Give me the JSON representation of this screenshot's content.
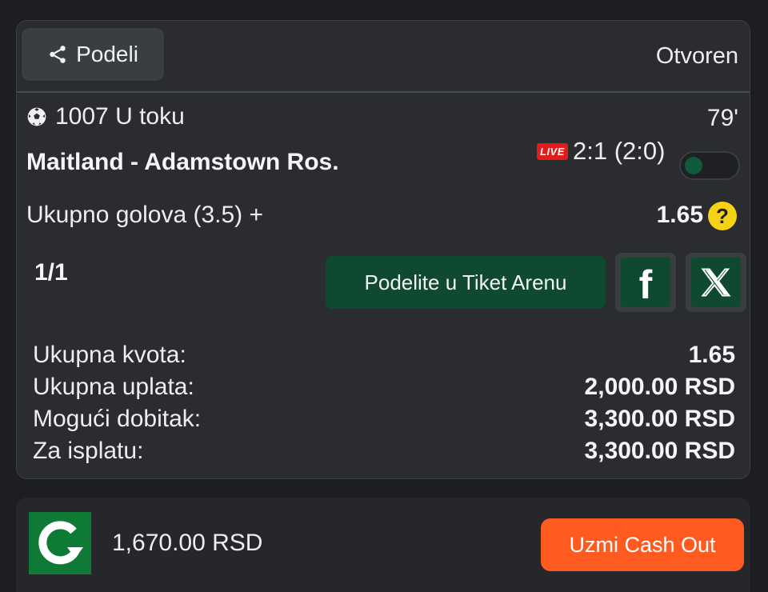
{
  "header": {
    "share_label": "Podeli",
    "status": "Otvoren"
  },
  "event": {
    "code_status": "1007 U toku",
    "minute": "79'",
    "teams": "Maitland - Adamstown Ros.",
    "live_badge": "LIVE",
    "score": "2:1 (2:0)",
    "sport_icon": "soccer-ball-icon"
  },
  "selection": {
    "market": "Ukupno golova (3.5) +",
    "odd": "1.65",
    "help": "?"
  },
  "ticket": {
    "count": "1/1",
    "arena_button": "Podelite u Tiket Arenu",
    "facebook_glyph": "f"
  },
  "summary": [
    {
      "label": "Ukupna kvota:",
      "value": "1.65"
    },
    {
      "label": "Ukupna uplata:",
      "value": "2,000.00 RSD"
    },
    {
      "label": "Mogući dobitak:",
      "value": "3,300.00 RSD"
    },
    {
      "label": "Za isplatu:",
      "value": "3,300.00 RSD"
    }
  ],
  "cashout": {
    "amount": "1,670.00 RSD",
    "button": "Uzmi Cash Out"
  },
  "colors": {
    "background": "#1c1e21",
    "card": "#2a2c30",
    "accent_green": "#0f4a30",
    "live_red": "#e41b1b",
    "help_yellow": "#f5d214",
    "cashout_orange": "#ff5a1f"
  }
}
